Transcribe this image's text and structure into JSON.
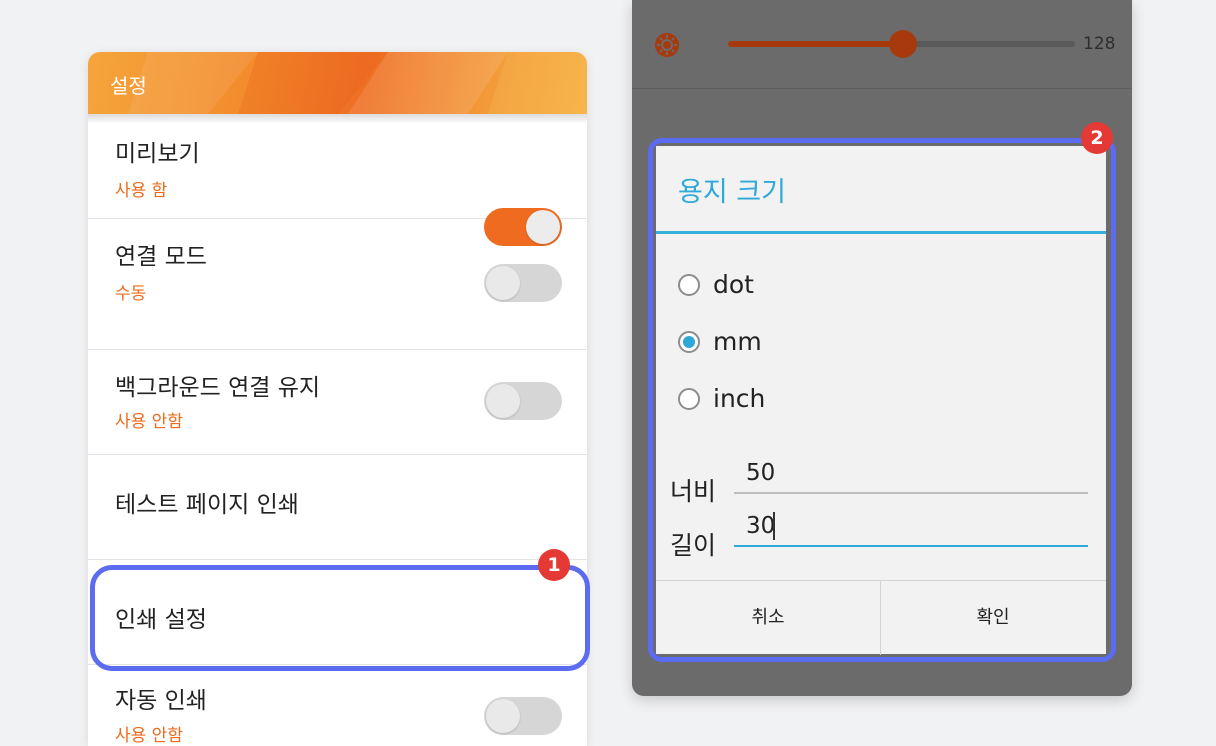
{
  "settings": {
    "title": "설정",
    "items": [
      {
        "title": "미리보기",
        "subtitle": "사용 함",
        "toggle": true
      },
      {
        "title": "연결 모드",
        "subtitle": "수동",
        "toggle": false
      },
      {
        "title": "백그라운드 연결 유지",
        "subtitle": "사용 안함",
        "toggle": false
      },
      {
        "title": "테스트 페이지 인쇄"
      },
      {
        "title": "인쇄 설정"
      },
      {
        "title": "자동 인쇄",
        "subtitle": "사용 안함",
        "toggle": false
      }
    ]
  },
  "brightness": {
    "value": "128",
    "level_fraction": 0.5
  },
  "dialog": {
    "title": "용지 크기",
    "unit_options": [
      "dot",
      "mm",
      "inch"
    ],
    "selected_unit": "mm",
    "width_label": "너비",
    "width_value": "50",
    "length_label": "길이",
    "length_value": "30",
    "cancel_label": "취소",
    "ok_label": "확인"
  },
  "callouts": {
    "badge1": "1",
    "badge2": "2"
  },
  "colors": {
    "accent_orange": "#ef6b1f",
    "dialog_accent": "#2ea8d8",
    "highlight": "#5b6cf0",
    "badge": "#e53935"
  }
}
